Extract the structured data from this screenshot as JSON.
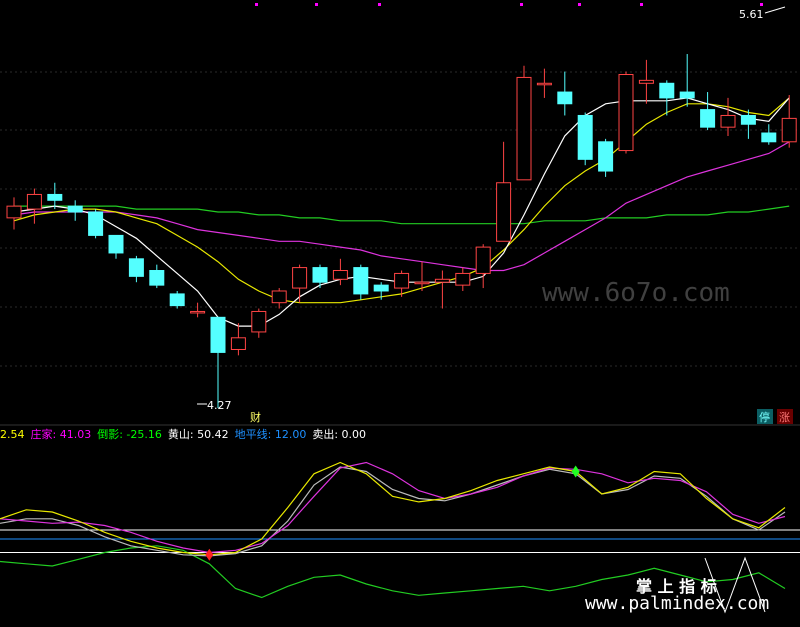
{
  "chart_data": [
    {
      "type": "candlestick",
      "panel": "price",
      "high_label": "5.61",
      "low_label": "4.27",
      "badge_cai": "财",
      "badge_ting": "停",
      "badge_zhang": "涨",
      "candles": [
        {
          "o": 4.92,
          "c": 4.96,
          "h": 4.99,
          "l": 4.88
        },
        {
          "o": 4.95,
          "c": 5.0,
          "h": 5.02,
          "l": 4.9
        },
        {
          "o": 5.0,
          "c": 4.98,
          "h": 5.04,
          "l": 4.95
        },
        {
          "o": 4.96,
          "c": 4.94,
          "h": 4.98,
          "l": 4.91
        },
        {
          "o": 4.94,
          "c": 4.86,
          "h": 4.95,
          "l": 4.85
        },
        {
          "o": 4.86,
          "c": 4.8,
          "h": 4.86,
          "l": 4.78
        },
        {
          "o": 4.78,
          "c": 4.72,
          "h": 4.79,
          "l": 4.7
        },
        {
          "o": 4.74,
          "c": 4.69,
          "h": 4.76,
          "l": 4.68
        },
        {
          "o": 4.66,
          "c": 4.62,
          "h": 4.67,
          "l": 4.61
        },
        {
          "o": 4.6,
          "c": 4.6,
          "h": 4.63,
          "l": 4.58
        },
        {
          "o": 4.58,
          "c": 4.46,
          "h": 4.58,
          "l": 4.27
        },
        {
          "o": 4.47,
          "c": 4.51,
          "h": 4.56,
          "l": 4.45
        },
        {
          "o": 4.53,
          "c": 4.6,
          "h": 4.61,
          "l": 4.51
        },
        {
          "o": 4.63,
          "c": 4.67,
          "h": 4.68,
          "l": 4.61
        },
        {
          "o": 4.68,
          "c": 4.75,
          "h": 4.76,
          "l": 4.63
        },
        {
          "o": 4.75,
          "c": 4.7,
          "h": 4.76,
          "l": 4.68
        },
        {
          "o": 4.71,
          "c": 4.74,
          "h": 4.78,
          "l": 4.69
        },
        {
          "o": 4.75,
          "c": 4.66,
          "h": 4.76,
          "l": 4.64
        },
        {
          "o": 4.69,
          "c": 4.67,
          "h": 4.7,
          "l": 4.64
        },
        {
          "o": 4.68,
          "c": 4.73,
          "h": 4.74,
          "l": 4.65
        },
        {
          "o": 4.7,
          "c": 4.7,
          "h": 4.77,
          "l": 4.67
        },
        {
          "o": 4.7,
          "c": 4.71,
          "h": 4.74,
          "l": 4.61
        },
        {
          "o": 4.69,
          "c": 4.73,
          "h": 4.75,
          "l": 4.67
        },
        {
          "o": 4.73,
          "c": 4.82,
          "h": 4.83,
          "l": 4.68
        },
        {
          "o": 4.84,
          "c": 5.04,
          "h": 5.18,
          "l": 4.84
        },
        {
          "o": 5.05,
          "c": 5.4,
          "h": 5.44,
          "l": 5.05
        },
        {
          "o": 5.38,
          "c": 5.38,
          "h": 5.43,
          "l": 5.33
        },
        {
          "o": 5.35,
          "c": 5.31,
          "h": 5.42,
          "l": 5.27
        },
        {
          "o": 5.27,
          "c": 5.12,
          "h": 5.28,
          "l": 5.1
        },
        {
          "o": 5.18,
          "c": 5.08,
          "h": 5.19,
          "l": 5.06
        },
        {
          "o": 5.15,
          "c": 5.41,
          "h": 5.42,
          "l": 5.14
        },
        {
          "o": 5.38,
          "c": 5.39,
          "h": 5.46,
          "l": 5.31
        },
        {
          "o": 5.38,
          "c": 5.33,
          "h": 5.39,
          "l": 5.27
        },
        {
          "o": 5.35,
          "c": 5.33,
          "h": 5.48,
          "l": 5.3
        },
        {
          "o": 5.29,
          "c": 5.23,
          "h": 5.35,
          "l": 5.22
        },
        {
          "o": 5.23,
          "c": 5.27,
          "h": 5.33,
          "l": 5.2
        },
        {
          "o": 5.27,
          "c": 5.24,
          "h": 5.29,
          "l": 5.19
        },
        {
          "o": 5.21,
          "c": 5.18,
          "h": 5.24,
          "l": 5.17
        },
        {
          "o": 5.18,
          "c": 5.26,
          "h": 5.34,
          "l": 5.16
        }
      ],
      "ma_white": [
        4.94,
        4.95,
        4.96,
        4.95,
        4.93,
        4.89,
        4.85,
        4.79,
        4.73,
        4.67,
        4.58,
        4.55,
        4.55,
        4.59,
        4.65,
        4.69,
        4.71,
        4.72,
        4.71,
        4.7,
        4.7,
        4.7,
        4.7,
        4.72,
        4.8,
        4.93,
        5.07,
        5.2,
        5.27,
        5.31,
        5.32,
        5.32,
        5.32,
        5.33,
        5.31,
        5.29,
        5.26,
        5.25,
        5.33
      ],
      "ma_yellow": [
        4.91,
        4.93,
        4.94,
        4.95,
        4.95,
        4.94,
        4.92,
        4.9,
        4.86,
        4.82,
        4.77,
        4.71,
        4.67,
        4.64,
        4.63,
        4.63,
        4.63,
        4.64,
        4.65,
        4.66,
        4.68,
        4.7,
        4.72,
        4.75,
        4.81,
        4.88,
        4.96,
        5.03,
        5.08,
        5.12,
        5.18,
        5.24,
        5.28,
        5.31,
        5.31,
        5.3,
        5.28,
        5.27,
        5.33
      ],
      "ma_magenta": [
        4.93,
        4.94,
        4.94,
        4.94,
        4.94,
        4.94,
        4.93,
        4.92,
        4.9,
        4.88,
        4.87,
        4.86,
        4.85,
        4.84,
        4.84,
        4.83,
        4.82,
        4.81,
        4.79,
        4.78,
        4.77,
        4.76,
        4.75,
        4.74,
        4.74,
        4.76,
        4.8,
        4.84,
        4.88,
        4.92,
        4.97,
        5.0,
        5.03,
        5.06,
        5.08,
        5.1,
        5.12,
        5.14,
        5.18
      ],
      "ma_green": [
        4.96,
        4.96,
        4.96,
        4.96,
        4.96,
        4.96,
        4.95,
        4.95,
        4.95,
        4.95,
        4.94,
        4.94,
        4.93,
        4.93,
        4.92,
        4.92,
        4.91,
        4.91,
        4.91,
        4.9,
        4.9,
        4.9,
        4.9,
        4.9,
        4.9,
        4.9,
        4.91,
        4.91,
        4.91,
        4.92,
        4.92,
        4.92,
        4.93,
        4.93,
        4.93,
        4.94,
        4.94,
        4.95,
        4.96
      ]
    },
    {
      "type": "line",
      "panel": "indicator",
      "readout": [
        {
          "name": "",
          "value": "2.54",
          "color": "#ffff00"
        },
        {
          "name": "庄家:",
          "value": "41.03",
          "color": "#ff00ff"
        },
        {
          "name": "倒影:",
          "value": "-25.16",
          "color": "#00ff00"
        },
        {
          "name": "黄山:",
          "value": "50.42",
          "color": "#ffffff"
        },
        {
          "name": "地平线:",
          "value": "12.00",
          "color": "#1e90ff"
        },
        {
          "name": "卖出:",
          "value": "0.00",
          "color": "#ffffff"
        }
      ],
      "ylim": [
        -60,
        100
      ],
      "horizontal_levels": [
        {
          "y": 12,
          "color": "#1e90ff"
        },
        {
          "y": 20,
          "color": "#ffffff"
        },
        {
          "y": 0,
          "color": "#ffffff"
        }
      ],
      "yellow": [
        30,
        38,
        36,
        28,
        18,
        10,
        4,
        0,
        -2,
        0,
        12,
        40,
        70,
        80,
        70,
        50,
        45,
        48,
        55,
        64,
        70,
        76,
        72,
        52,
        58,
        72,
        70,
        48,
        30,
        22,
        40
      ],
      "magenta": [
        30,
        28,
        26,
        27,
        24,
        18,
        10,
        4,
        0,
        2,
        8,
        24,
        50,
        75,
        80,
        70,
        55,
        48,
        52,
        58,
        68,
        75,
        74,
        70,
        62,
        66,
        64,
        54,
        34,
        26,
        32
      ],
      "white": [
        26,
        30,
        30,
        24,
        14,
        6,
        2,
        -2,
        -3,
        -1,
        6,
        28,
        60,
        76,
        72,
        56,
        48,
        46,
        52,
        60,
        68,
        74,
        70,
        52,
        56,
        68,
        66,
        50,
        30,
        20,
        36
      ],
      "green": [
        -8,
        -10,
        -12,
        -6,
        0,
        4,
        6,
        2,
        -10,
        -32,
        -40,
        -30,
        -22,
        -20,
        -28,
        -34,
        -38,
        -36,
        -34,
        -32,
        -30,
        -34,
        -30,
        -24,
        -20,
        -14,
        -20,
        -26,
        -24,
        -18,
        -32
      ],
      "buy_marker_index": 8,
      "sell_marker_index": 22
    }
  ],
  "watermarks": {
    "top": "www.6o7o.com",
    "cn": "掌 上 指 标",
    "bottom": "www.palmindex.com"
  }
}
